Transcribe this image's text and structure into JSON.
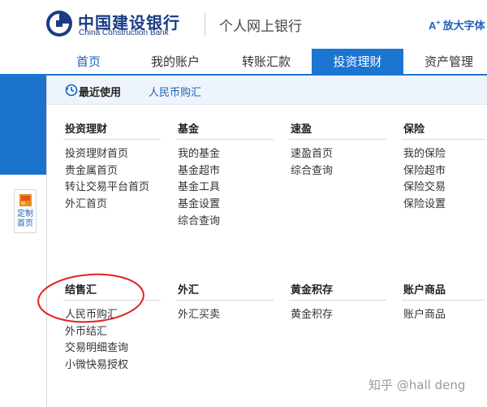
{
  "header": {
    "logo_cn": "中国建设银行",
    "logo_en": "China Construction Bank",
    "subtitle": "个人网上银行",
    "zoom_label": "放大字体",
    "zoom_icon": "A"
  },
  "nav": {
    "items": [
      {
        "label": "首页"
      },
      {
        "label": "我的账户"
      },
      {
        "label": "转账汇款"
      },
      {
        "label": "投资理财",
        "active": true
      },
      {
        "label": "资产管理"
      }
    ]
  },
  "side": {
    "custom_home_label": "定制首页"
  },
  "recent": {
    "label": "最近使用",
    "link": "人民币购汇"
  },
  "sections": [
    {
      "title": "投资理财",
      "links": [
        "投资理财首页",
        "贵金属首页",
        "转让交易平台首页",
        "外汇首页"
      ]
    },
    {
      "title": "基金",
      "links": [
        "我的基金",
        "基金超市",
        "基金工具",
        "基金设置",
        "综合查询"
      ]
    },
    {
      "title": "速盈",
      "links": [
        "速盈首页",
        "综合查询"
      ]
    },
    {
      "title": "保险",
      "links": [
        "我的保险",
        "保险超市",
        "保险交易",
        "保险设置"
      ]
    },
    {
      "title": "结售汇",
      "links": [
        "人民币购汇",
        "外币结汇",
        "交易明细查询",
        "小微快易授权"
      ]
    },
    {
      "title": "外汇",
      "links": [
        "外汇买卖"
      ]
    },
    {
      "title": "黄金积存",
      "links": [
        "黄金积存"
      ]
    },
    {
      "title": "账户商品",
      "links": [
        "账户商品"
      ]
    }
  ],
  "watermark": "知乎 @hall deng",
  "colors": {
    "brand_blue": "#1b76d1",
    "link_blue": "#1c62b9",
    "annotation_red": "#e02020",
    "logo_blue": "#1a3b84"
  }
}
